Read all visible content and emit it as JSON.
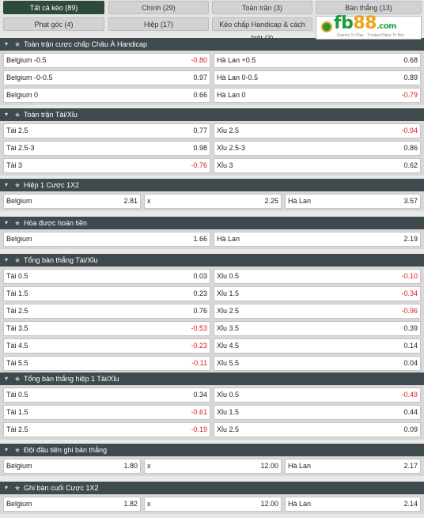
{
  "tabs": [
    {
      "label": "Tất cả kèo (89)",
      "active": true
    },
    {
      "label": "Chính (29)",
      "active": false
    },
    {
      "label": "Toàn trận (3)",
      "active": false
    },
    {
      "label": "Bàn thắng (13)",
      "active": false
    },
    {
      "label": "Phạt góc (4)",
      "active": false
    },
    {
      "label": "Hiệp (17)",
      "active": false
    },
    {
      "label": "Kèo chấp Handicap & cách biệt (3)",
      "active": false
    }
  ],
  "logo": {
    "brand": "fb",
    "number": "88",
    "domain": ".com",
    "tagline": "Games To Play · Trusted Place To Bet"
  },
  "icons": {
    "collapse": "chevron-down-icon",
    "favorite": "star-icon"
  },
  "colors": {
    "negative": "#e01b1b",
    "header": "#3f4a4e",
    "active_tab": "#2e4a3a"
  },
  "sections": [
    {
      "title": "Toàn trận cược chấp Châu Á Handicap",
      "cols": 2,
      "rows": [
        [
          {
            "label": "Belgium -0.5",
            "odd": "-0.80"
          },
          {
            "label": "Hà Lan +0.5",
            "odd": "0.68"
          }
        ],
        [
          {
            "label": "Belgium -0-0.5",
            "odd": "0.97"
          },
          {
            "label": "Hà Lan 0-0.5",
            "odd": "0.89"
          }
        ],
        [
          {
            "label": "Belgium 0",
            "odd": "0.66"
          },
          {
            "label": "Hà Lan 0",
            "odd": "-0.79"
          }
        ]
      ]
    },
    {
      "title": "Toàn trận Tài/Xỉu",
      "cols": 2,
      "rows": [
        [
          {
            "label": "Tài 2.5",
            "odd": "0.77"
          },
          {
            "label": "Xỉu 2.5",
            "odd": "-0.94"
          }
        ],
        [
          {
            "label": "Tài 2.5-3",
            "odd": "0.98"
          },
          {
            "label": "Xỉu 2.5-3",
            "odd": "0.86"
          }
        ],
        [
          {
            "label": "Tài 3",
            "odd": "-0.76"
          },
          {
            "label": "Xỉu 3",
            "odd": "0.62"
          }
        ]
      ]
    },
    {
      "title": "Hiệp 1 Cược 1X2",
      "cols": 3,
      "rows": [
        [
          {
            "label": "Belgium",
            "odd": "2.81"
          },
          {
            "label": "x",
            "odd": "2.25"
          },
          {
            "label": "Hà Lan",
            "odd": "3.57"
          }
        ]
      ]
    },
    {
      "title": "Hòa được hoàn tiền",
      "cols": 2,
      "rows": [
        [
          {
            "label": "Belgium",
            "odd": "1.66"
          },
          {
            "label": "Hà Lan",
            "odd": "2.19"
          }
        ]
      ]
    },
    {
      "title": "Tổng bàn thắng Tài/Xỉu",
      "cols": 2,
      "rows": [
        [
          {
            "label": "Tài 0.5",
            "odd": "0.03"
          },
          {
            "label": "Xỉu 0.5",
            "odd": "-0.10"
          }
        ],
        [
          {
            "label": "Tài 1.5",
            "odd": "0.23"
          },
          {
            "label": "Xỉu 1.5",
            "odd": "-0.34"
          }
        ],
        [
          {
            "label": "Tài 2.5",
            "odd": "0.76"
          },
          {
            "label": "Xỉu 2.5",
            "odd": "-0.96"
          }
        ],
        [
          {
            "label": "Tài 3.5",
            "odd": "-0.53"
          },
          {
            "label": "Xỉu 3.5",
            "odd": "0.39"
          }
        ],
        [
          {
            "label": "Tài 4.5",
            "odd": "-0.23"
          },
          {
            "label": "Xỉu 4.5",
            "odd": "0.14"
          }
        ],
        [
          {
            "label": "Tài 5.5",
            "odd": "-0.11"
          },
          {
            "label": "Xỉu 5.5",
            "odd": "0.04"
          }
        ]
      ]
    },
    {
      "title": "Tổng bàn thắng hiệp 1 Tài/Xỉu",
      "cols": 2,
      "rows": [
        [
          {
            "label": "Tài 0.5",
            "odd": "0.34"
          },
          {
            "label": "Xỉu 0.5",
            "odd": "-0.49"
          }
        ],
        [
          {
            "label": "Tài 1.5",
            "odd": "-0.61"
          },
          {
            "label": "Xỉu 1.5",
            "odd": "0.44"
          }
        ],
        [
          {
            "label": "Tài 2.5",
            "odd": "-0.19"
          },
          {
            "label": "Xỉu 2.5",
            "odd": "0.09"
          }
        ]
      ]
    },
    {
      "title": "Đội đầu tiên ghi bàn thắng",
      "cols": 3,
      "rows": [
        [
          {
            "label": "Belgium",
            "odd": "1.80"
          },
          {
            "label": "x",
            "odd": "12.00"
          },
          {
            "label": "Hà Lan",
            "odd": "2.17"
          }
        ]
      ]
    },
    {
      "title": "Ghi bàn cuối Cược 1X2",
      "cols": 3,
      "rows": [
        [
          {
            "label": "Belgium",
            "odd": "1.82"
          },
          {
            "label": "x",
            "odd": "12.00"
          },
          {
            "label": "Hà Lan",
            "odd": "2.14"
          }
        ]
      ]
    }
  ]
}
